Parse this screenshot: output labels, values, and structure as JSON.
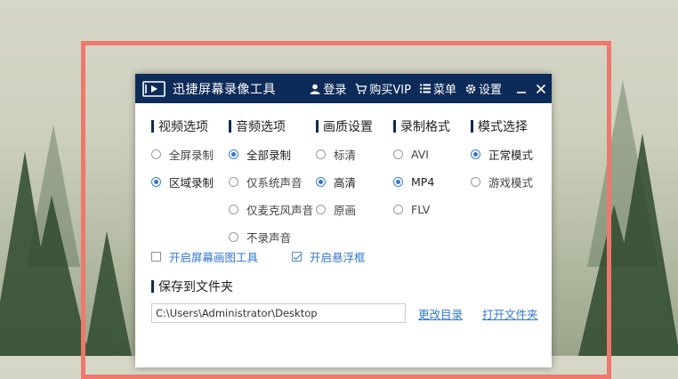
{
  "app": {
    "title": "迅捷屏幕录像工具"
  },
  "titlebar": {
    "login": "登录",
    "vip": "购买VIP",
    "menu": "菜单",
    "settings": "设置"
  },
  "columns": [
    {
      "heading": "视频选项",
      "options": [
        {
          "label": "全屏录制",
          "selected": false
        },
        {
          "label": "区域录制",
          "selected": true
        }
      ]
    },
    {
      "heading": "音频选项",
      "options": [
        {
          "label": "全部录制",
          "selected": true
        },
        {
          "label": "仅系统声音",
          "selected": false
        },
        {
          "label": "仅麦克风声音",
          "selected": false
        },
        {
          "label": "不录声音",
          "selected": false
        }
      ]
    },
    {
      "heading": "画质设置",
      "options": [
        {
          "label": "标清",
          "selected": false
        },
        {
          "label": "高清",
          "selected": true
        },
        {
          "label": "原画",
          "selected": false
        }
      ]
    },
    {
      "heading": "录制格式",
      "options": [
        {
          "label": "AVI",
          "selected": false
        },
        {
          "label": "MP4",
          "selected": true
        },
        {
          "label": "FLV",
          "selected": false
        }
      ]
    },
    {
      "heading": "模式选择",
      "options": [
        {
          "label": "正常模式",
          "selected": true
        },
        {
          "label": "游戏模式",
          "selected": false
        }
      ]
    }
  ],
  "checkboxes": [
    {
      "label": "开启屏幕画图工具",
      "checked": false
    },
    {
      "label": "开启悬浮框",
      "checked": true
    }
  ],
  "save": {
    "heading": "保存到文件夹",
    "path": "C:\\Users\\Administrator\\Desktop",
    "change_dir": "更改目录",
    "open_folder": "打开文件夹"
  },
  "colors": {
    "titlebar": "#0d2b58",
    "accent": "#2f78d2",
    "frame": "#f0776c"
  }
}
